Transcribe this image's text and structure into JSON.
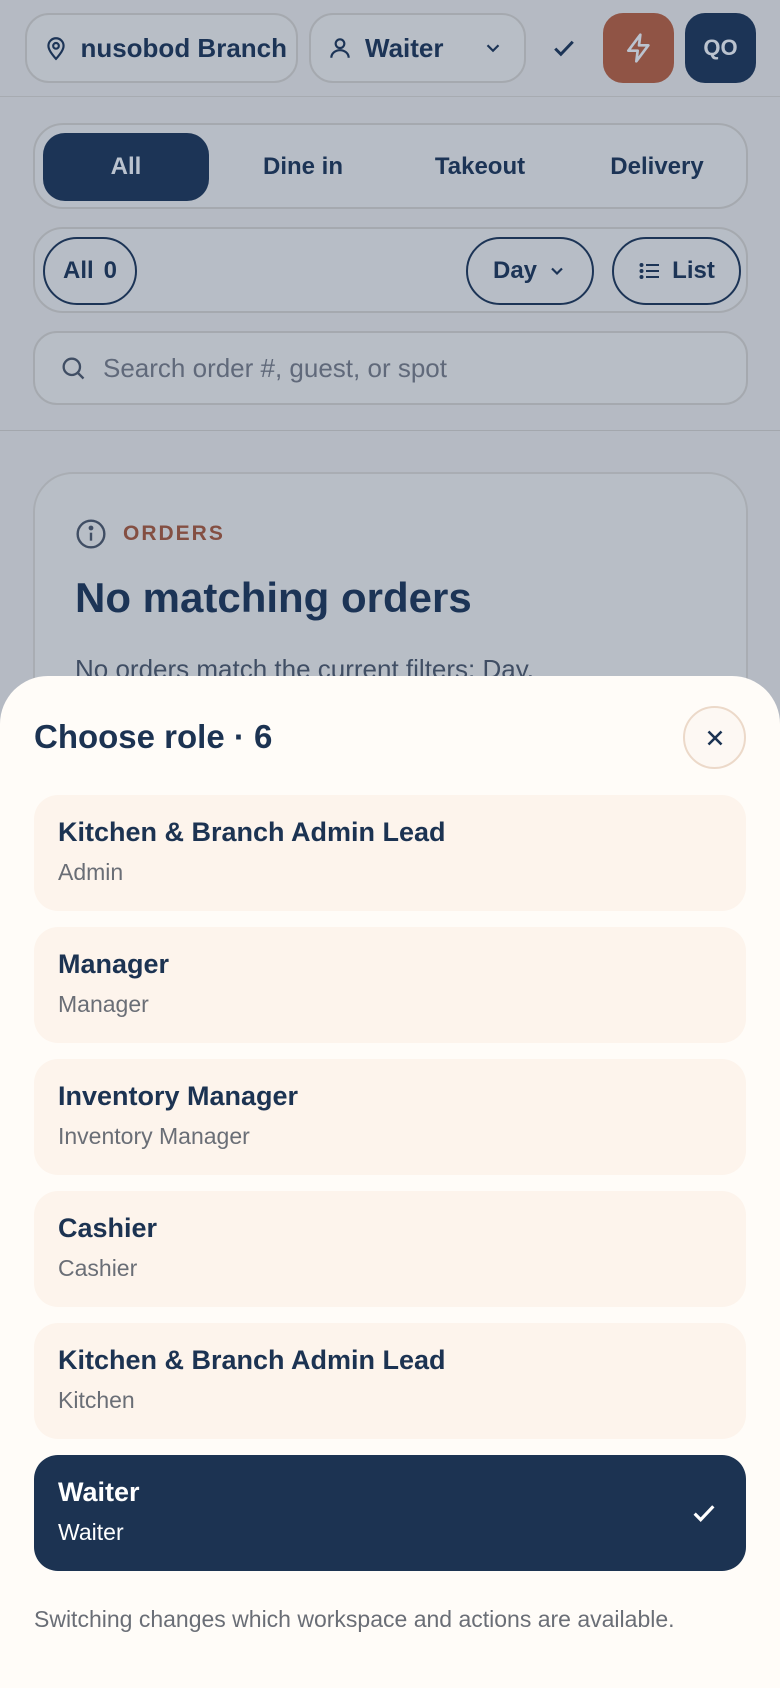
{
  "header": {
    "branch_label": "Yunusobod Branch",
    "role_label": "Waiter",
    "avatar_initials": "QO"
  },
  "tabs": [
    {
      "label": "All",
      "active": true
    },
    {
      "label": "Dine in",
      "active": false
    },
    {
      "label": "Takeout",
      "active": false
    },
    {
      "label": "Delivery",
      "active": false
    }
  ],
  "filters": {
    "all_label": "All",
    "all_count": "0",
    "period_label": "Day",
    "view_label": "List"
  },
  "search": {
    "placeholder": "Search order #, guest, or spot"
  },
  "empty_card": {
    "eyebrow": "ORDERS",
    "title": "No matching orders",
    "description": "No orders match the current filters: Day."
  },
  "role_sheet": {
    "title": "Choose role · 6",
    "roles": [
      {
        "name": "Kitchen & Branch Admin Lead",
        "subtitle": "Admin",
        "selected": false
      },
      {
        "name": "Manager",
        "subtitle": "Manager",
        "selected": false
      },
      {
        "name": "Inventory Manager",
        "subtitle": "Inventory Manager",
        "selected": false
      },
      {
        "name": "Cashier",
        "subtitle": "Cashier",
        "selected": false
      },
      {
        "name": "Kitchen & Branch Admin Lead",
        "subtitle": "Kitchen",
        "selected": false
      },
      {
        "name": "Waiter",
        "subtitle": "Waiter",
        "selected": true
      }
    ],
    "footnote": "Switching changes which workspace and actions are available."
  },
  "colors": {
    "navy": "#1c3352",
    "accent_orange": "#c2603a",
    "cream": "#fdf4ec"
  }
}
